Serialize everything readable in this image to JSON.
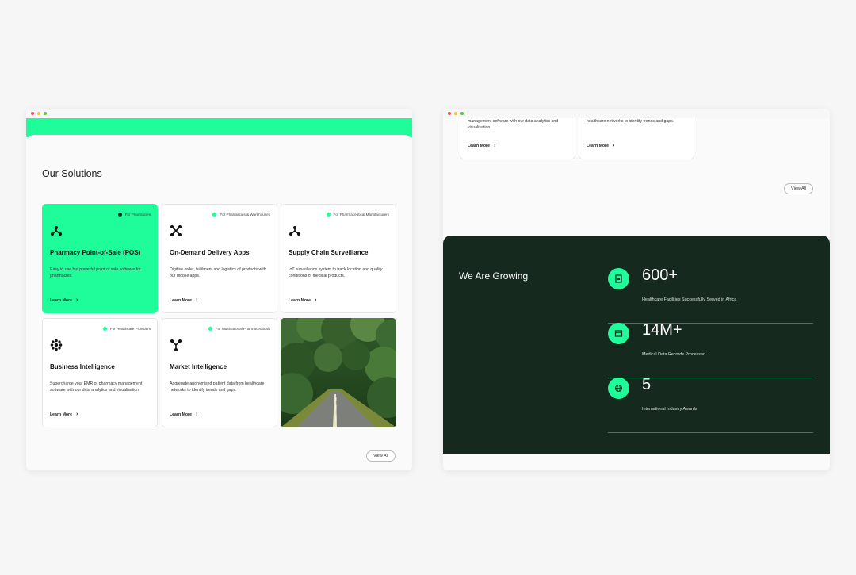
{
  "left_window": {
    "section_title": "Our Solutions",
    "cards": [
      {
        "tag": "For Pharmacies",
        "icon": "tri-node-icon",
        "title": "Pharmacy Point-of-Sale (POS)",
        "desc": "Easy to use but powerful point of sale software for pharmacies.",
        "link": "Learn More"
      },
      {
        "tag": "For Pharmacies & Warehouses",
        "icon": "cross-node-icon",
        "title": "On-Demand Delivery Apps",
        "desc": "Digitise order, fulfilment and logistics of products with our mobile apps.",
        "link": "Learn More"
      },
      {
        "tag": "For Pharmaceutical Manufacturers",
        "icon": "tri-node-icon",
        "title": "Supply Chain Surveillance",
        "desc": "IoT surveillance system to track location and quality conditions of medical products.",
        "link": "Learn More"
      },
      {
        "tag": "For Healthcare Providers",
        "icon": "asterisk-flower-icon",
        "title": "Business Intelligence",
        "desc": "Supercharge your EMR or pharmacy management software with our data analytics and visualisation.",
        "link": "Learn More"
      },
      {
        "tag": "For Multinational Pharmaceuticals",
        "icon": "y-node-icon",
        "title": "Market Intelligence",
        "desc": "Aggregate anonymised patient data from healthcare networks to identify trends and gaps.",
        "link": "Learn More"
      }
    ],
    "view_all": "View All"
  },
  "right_window": {
    "top_cards": [
      {
        "desc": "management software with our data analytics and visualisation.",
        "link": "Learn More"
      },
      {
        "desc": "healthcare networks to identify trends and gaps.",
        "link": "Learn More"
      }
    ],
    "view_all": "View All",
    "growth": {
      "title": "We Are Growing",
      "stats": [
        {
          "value": "600+",
          "label": "Healthcare Facilities Successfully Served in Africa",
          "icon": "building-icon"
        },
        {
          "value": "14M+",
          "label": "Medical Data Records Processed",
          "icon": "database-icon"
        },
        {
          "value": "5",
          "label": "International Industry Awards",
          "icon": "globe-icon"
        }
      ]
    }
  },
  "colors": {
    "accent": "#1ffc9a",
    "dark": "#16291f",
    "page_bg": "#f6f6f6"
  }
}
